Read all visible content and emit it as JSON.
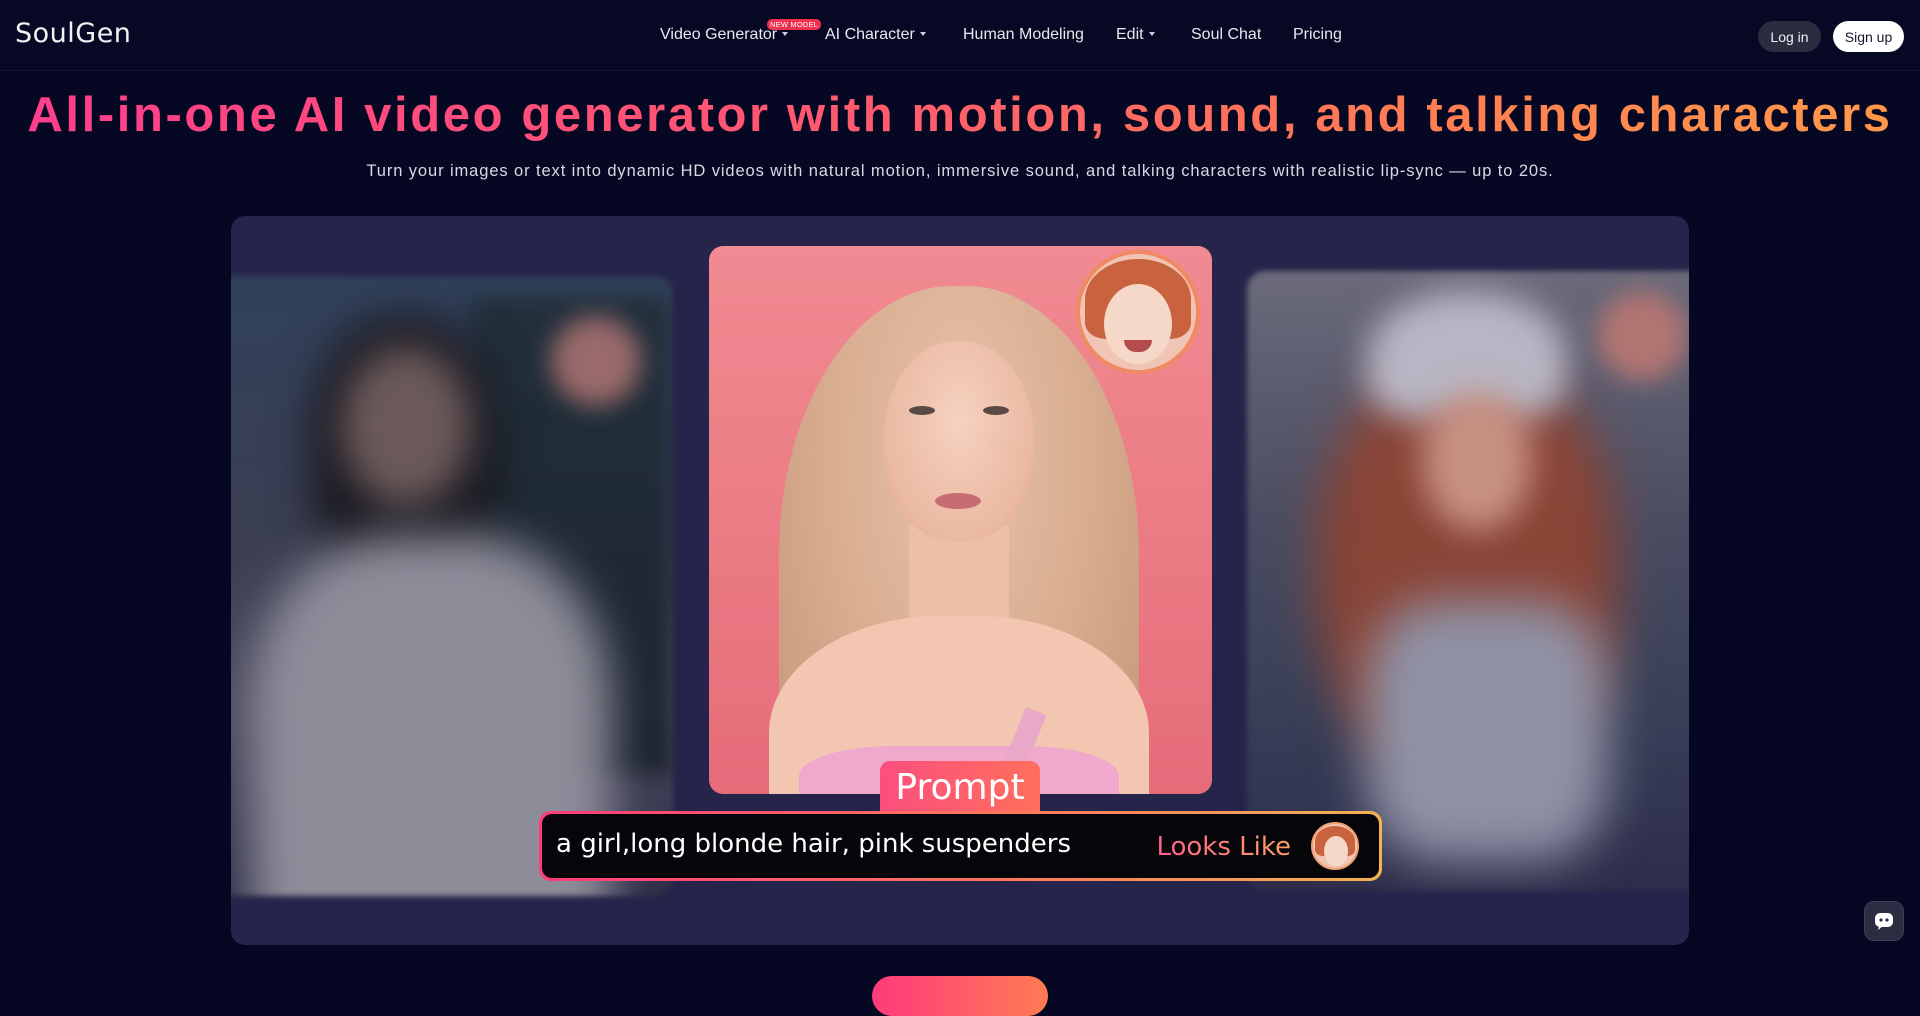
{
  "brand": {
    "logo": "SoulGen"
  },
  "nav": {
    "items": [
      {
        "label": "Video Generator",
        "has_caret": true
      },
      {
        "label": "AI Character",
        "has_caret": true
      },
      {
        "label": "Human Modeling",
        "has_caret": false
      },
      {
        "label": "Edit",
        "has_caret": true
      },
      {
        "label": "Soul Chat",
        "has_caret": false
      },
      {
        "label": "Pricing",
        "has_caret": false
      }
    ],
    "new_badge": "NEW MODEL",
    "login": "Log in",
    "signup": "Sign up"
  },
  "hero": {
    "title": "All-in-one AI video generator with motion, sound, and talking characters",
    "subtitle": "Turn your images or text into dynamic HD videos with natural motion, immersive sound, and talking characters with realistic lip-sync — up to 20s."
  },
  "showcase": {
    "prompt_tag": "Prompt",
    "prompt_text": "a girl,long blonde hair, pink suspenders",
    "looks_like": "Looks Like"
  },
  "colors": {
    "background": "#060722",
    "accent_pink": "#ff3e8c",
    "accent_orange": "#ff9a48",
    "panel": "#26244a"
  },
  "icons": {
    "chat_widget": "chat-bubble-icon",
    "dropdown": "chevron-down-icon"
  }
}
